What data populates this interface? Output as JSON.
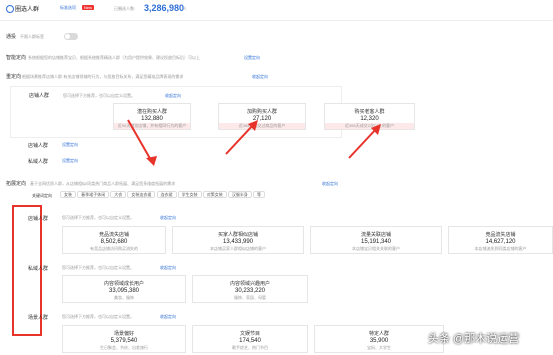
{
  "header": {
    "title": "圈选人群",
    "link": "标准选项",
    "badge": "New",
    "count_label": "已圈选人数:",
    "count_value": "3,286,980",
    "count_unit": "人"
  },
  "toggle": {
    "label": "通投",
    "hint": "不限人群标签"
  },
  "smart": {
    "label": "智能定向",
    "desc": "系统根据您的店铺推荐宝贝、根据系统推荐精选人群（为用户提供效果、建议投放目标后）可以上",
    "link": "设置定向"
  },
  "focus": {
    "label": "重定向",
    "desc": "根据场景推荐店铺人群·有关店铺领域的行为，与投放目标关系，满足您精准品牌表现的需求",
    "link": "收起定向"
  },
  "shop_group": {
    "label": "店铺人群",
    "hint": "您可选择下方推荐，也可以自定义设置。",
    "link": "收起定向",
    "cards": [
      {
        "title": "潜在购买人群",
        "value": "132,880",
        "desc": "近90天浏览店铺，并有相同行为的客户"
      },
      {
        "title": "加购购买人群",
        "value": "27,120",
        "desc": "近365天成交过商品的客户"
      },
      {
        "title": "购买老客人群",
        "value": "12,320",
        "desc": "近365天成交2次以上的客户"
      }
    ]
  },
  "keep_group": {
    "label": "店铺人群",
    "link": "设置定向"
  },
  "private_group": {
    "label": "私域人群",
    "link": "设置定向"
  },
  "expand": {
    "label": "拓展定向",
    "desc": "基于全网优质人群，从店铺相似/同类热门商品人群拓展、满足您多维度拓展的需求",
    "link": "收起定向"
  },
  "keyword_row": {
    "label": "关键词定向",
    "tags": [
      "女装",
      "春季裙子休闲",
      "大衣",
      "女装连衣裙",
      "连衣裙",
      "学生女装",
      "对策女装",
      "汉服半身",
      "等"
    ]
  },
  "groups": [
    {
      "label": "店铺人群",
      "hint": "您可选择下方推荐，也可以自定义设置。",
      "link": "收起定向",
      "cards": [
        {
          "title": "竞品流失店铺",
          "value": "8,502,680",
          "desc": "有竞品店铺访问购买流失的"
        },
        {
          "title": "买家人群相似店铺",
          "value": "13,433,990",
          "desc": "本店铺买家人群相似店铺的客户"
        },
        {
          "title": "流量关联店铺",
          "value": "15,191,340",
          "desc": "本店铺宝贝相关关联的客户"
        },
        {
          "title": "竞品流失店铺",
          "value": "14,627,120",
          "desc": "本店铺流失到同类店铺的客户"
        }
      ]
    },
    {
      "label": "私域人群",
      "hint": "您可选择下方推荐，也可以自定义设置。",
      "link": "收起定向",
      "cards": [
        {
          "title": "内容领域成长用户",
          "value": "33,095,380",
          "desc": "美妆、服饰"
        },
        {
          "title": "内容领域兴趣用户",
          "value": "30,233,220",
          "desc": "服饰、家居、母婴"
        }
      ]
    },
    {
      "label": "场景人群",
      "hint": "您可选择下方推荐，也可以自定义设置。",
      "link": "收起定向",
      "cards": [
        {
          "title": "场景偏好",
          "value": "5,379,540",
          "desc": "生日聚会、节庆、出差旅行"
        },
        {
          "title": "文娱节目",
          "value": "174,540",
          "desc": "歌手综艺、热门节目"
        },
        {
          "title": "特定人群",
          "value": "35,900",
          "desc": "宝妈、大学生"
        }
      ]
    }
  ],
  "watermark": "头条 @那木说运营"
}
